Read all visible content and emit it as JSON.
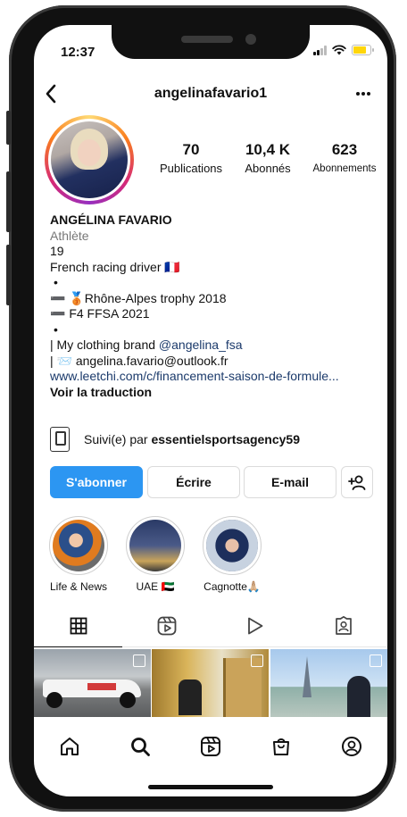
{
  "status": {
    "time": "12:37"
  },
  "header": {
    "username": "angelinafavario1"
  },
  "stats": {
    "posts": {
      "count": "70",
      "label": "Publications"
    },
    "followers": {
      "count": "10,4 K",
      "label": "Abonnés"
    },
    "following": {
      "count": "623",
      "label": "Abonnements"
    }
  },
  "bio": {
    "name": "ANGÉLINA FAVARIO",
    "category": "Athlète",
    "lines": {
      "l1": "19",
      "l2": "French racing driver 🇫🇷",
      "l3": "•",
      "l4": "➖ 🥉Rhône-Alpes trophy 2018",
      "l5": "➖ F4 FFSA 2021",
      "l6": "•",
      "l7_prefix": "|   My clothing brand ",
      "l7_mention": "@angelina_fsa",
      "l8": "|   📨 angelina.favario@outlook.fr"
    },
    "link": "www.leetchi.com/c/financement-saison-de-formule...",
    "translate": "Voir la traduction"
  },
  "followed_by": {
    "prefix": "Suivi(e) par ",
    "account": "essentielsportsagency59"
  },
  "actions": {
    "follow": "S'abonner",
    "message": "Écrire",
    "email": "E-mail"
  },
  "highlights": [
    {
      "label": "Life & News"
    },
    {
      "label": "UAE 🇦🇪"
    },
    {
      "label": "Cagnotte🙏🏼"
    }
  ],
  "colors": {
    "accent": "#2c96f2",
    "link": "#1b3a6b",
    "muted": "#777777"
  }
}
